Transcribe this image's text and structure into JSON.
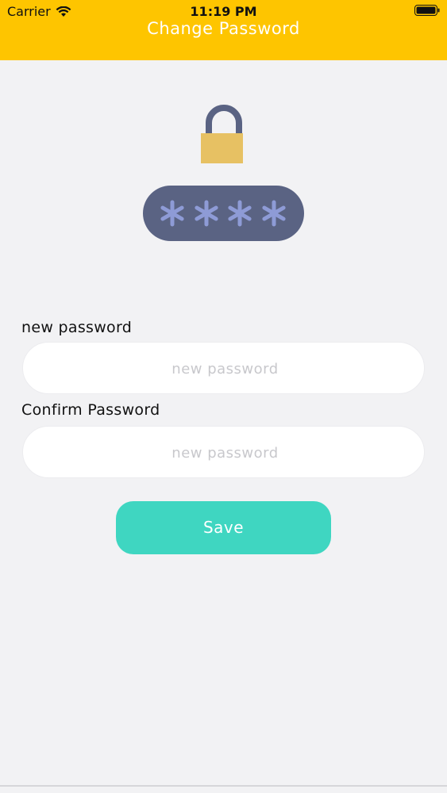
{
  "status_bar": {
    "carrier": "Carrier",
    "time": "11:19 PM",
    "wifi_icon": "wifi-icon",
    "battery_icon": "battery-icon"
  },
  "header": {
    "title": "Change Password",
    "background_color": "#fec500"
  },
  "illustration": {
    "icon": "padlock-password-icon",
    "masked_text": "****"
  },
  "form": {
    "new_password": {
      "label": "new password",
      "placeholder": "new password",
      "value": ""
    },
    "confirm_password": {
      "label": "Confirm Password",
      "placeholder": "new password",
      "value": ""
    },
    "save_label": "Save",
    "save_color": "#3fd6c1"
  }
}
